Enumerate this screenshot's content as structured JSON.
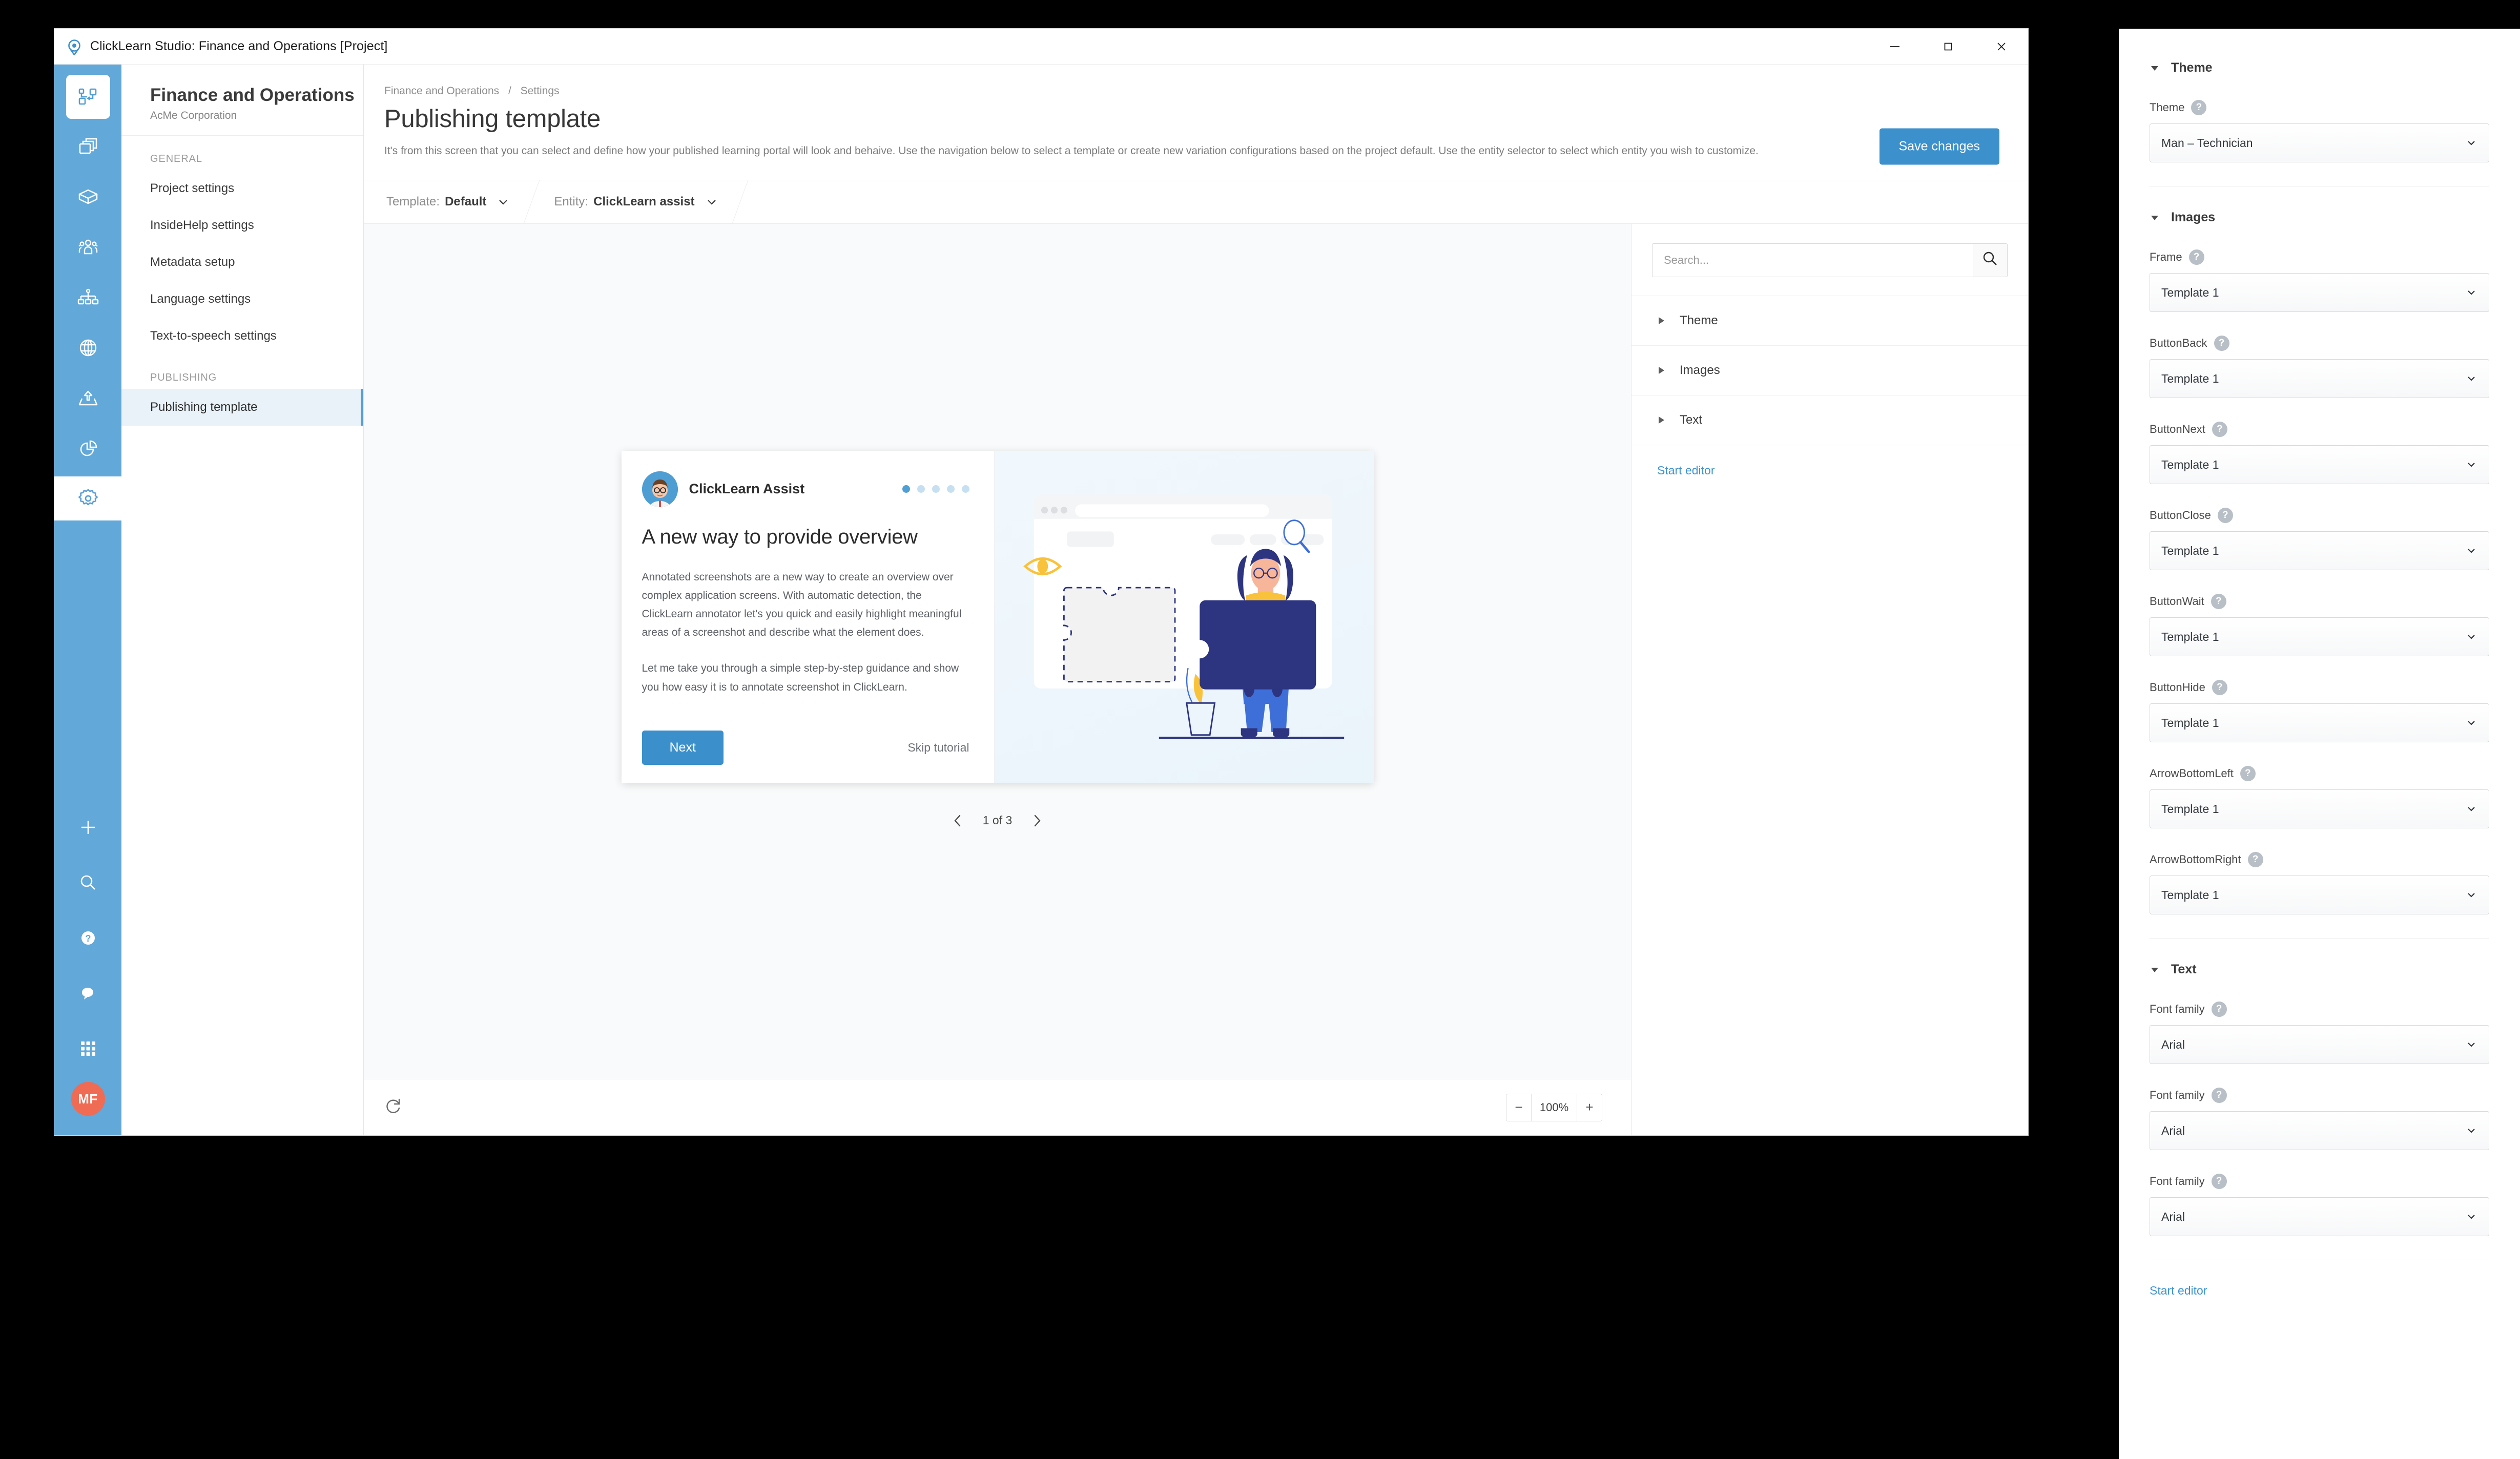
{
  "window": {
    "title": "ClickLearn Studio: Finance and Operations [Project]",
    "logo_icon": "clicklearn-logo-icon",
    "minimize_icon": "minimize-icon",
    "maximize_icon": "maximize-icon",
    "close_icon": "close-icon"
  },
  "rail": {
    "top_icons": [
      {
        "name": "project-overview-icon",
        "active": true
      },
      {
        "name": "copy-pages-icon",
        "active": false
      },
      {
        "name": "package-box-icon",
        "active": false
      },
      {
        "name": "audience-group-icon",
        "active": false
      },
      {
        "name": "sitemap-hierarchy-icon",
        "active": false
      },
      {
        "name": "globe-language-icon",
        "active": false
      },
      {
        "name": "publish-upload-icon",
        "active": false
      },
      {
        "name": "analytics-pie-icon",
        "active": false
      },
      {
        "name": "settings-gear-icon",
        "active": true
      }
    ],
    "bottom_icons": [
      {
        "name": "add-plus-icon"
      },
      {
        "name": "search-icon"
      },
      {
        "name": "help-question-icon"
      },
      {
        "name": "feedback-chat-icon"
      },
      {
        "name": "apps-grid-icon"
      }
    ],
    "avatar_initials": "MF"
  },
  "nav": {
    "project_title": "Finance and Operations",
    "project_subtitle": "AcMe Corporation",
    "groups": [
      {
        "label": "GENERAL",
        "items": [
          {
            "label": "Project settings",
            "selected": false
          },
          {
            "label": "InsideHelp settings",
            "selected": false
          },
          {
            "label": "Metadata setup",
            "selected": false
          },
          {
            "label": "Language settings",
            "selected": false
          },
          {
            "label": "Text-to-speech settings",
            "selected": false
          }
        ]
      },
      {
        "label": "PUBLISHING",
        "items": [
          {
            "label": "Publishing template",
            "selected": true
          }
        ]
      }
    ]
  },
  "content": {
    "breadcrumb": {
      "root": "Finance and Operations",
      "separator": "/",
      "current": "Settings"
    },
    "page_title": "Publishing template",
    "page_description": "It's from this screen that you can select and define how your published learning portal will look and behaive. Use the navigation below to select a template or create new variation configurations based on the project default. Use the entity selector to select which entity you wish to customize.",
    "save_label": "Save changes",
    "selectors": [
      {
        "label": "Template:",
        "value": "Default",
        "icon": "chevron-down-icon"
      },
      {
        "label": "Entity:",
        "value": "ClickLearn assist",
        "icon": "chevron-down-icon"
      }
    ]
  },
  "preview": {
    "assistant_name": "ClickLearn Assist",
    "dots_total": 5,
    "dots_active_index": 0,
    "heading": "A new way to provide overview",
    "paragraph1": "Annotated screenshots are a new way to create an overview over complex application screens. With automatic detection, the ClickLearn annotator let's you quick and easily highlight meaningful areas of a screenshot and describe what the element does.",
    "paragraph2": "Let me take you through a simple step-by-step guidance and show you how easy it is to annotate screenshot in ClickLearn.",
    "next_label": "Next",
    "skip_label": "Skip tutorial",
    "pager": {
      "prev_icon": "chevron-left-icon",
      "next_icon": "chevron-right-icon",
      "current": "1",
      "of_word": "of",
      "total": "3",
      "text": "1 of 3"
    }
  },
  "canvas_footer": {
    "refresh_icon": "refresh-icon",
    "zoom_out_label": "−",
    "zoom_value": "100%",
    "zoom_in_label": "+"
  },
  "accordion": {
    "search_placeholder": "Search...",
    "search_value": "",
    "search_icon": "search-icon",
    "rows": [
      {
        "label": "Theme",
        "icon": "triangle-right-icon"
      },
      {
        "label": "Images",
        "icon": "triangle-right-icon"
      },
      {
        "label": "Text",
        "icon": "triangle-right-icon"
      }
    ],
    "start_editor_label": "Start editor"
  },
  "properties": {
    "sections": [
      {
        "title": "Theme",
        "icon": "triangle-down-icon",
        "fields": [
          {
            "label": "Theme",
            "value": "Man – Technician",
            "help_icon": "help-question-icon",
            "chevron_icon": "chevron-down-icon"
          }
        ]
      },
      {
        "title": "Images",
        "icon": "triangle-down-icon",
        "fields": [
          {
            "label": "Frame",
            "value": "Template 1",
            "help_icon": "help-question-icon",
            "chevron_icon": "chevron-down-icon"
          },
          {
            "label": "ButtonBack",
            "value": "Template 1",
            "help_icon": "help-question-icon",
            "chevron_icon": "chevron-down-icon"
          },
          {
            "label": "ButtonNext",
            "value": "Template 1",
            "help_icon": "help-question-icon",
            "chevron_icon": "chevron-down-icon"
          },
          {
            "label": "ButtonClose",
            "value": "Template 1",
            "help_icon": "help-question-icon",
            "chevron_icon": "chevron-down-icon"
          },
          {
            "label": "ButtonWait",
            "value": "Template 1",
            "help_icon": "help-question-icon",
            "chevron_icon": "chevron-down-icon"
          },
          {
            "label": "ButtonHide",
            "value": "Template 1",
            "help_icon": "help-question-icon",
            "chevron_icon": "chevron-down-icon"
          },
          {
            "label": "ArrowBottomLeft",
            "value": "Template 1",
            "help_icon": "help-question-icon",
            "chevron_icon": "chevron-down-icon"
          },
          {
            "label": "ArrowBottomRight",
            "value": "Template 1",
            "help_icon": "help-question-icon",
            "chevron_icon": "chevron-down-icon"
          }
        ]
      },
      {
        "title": "Text",
        "icon": "triangle-down-icon",
        "fields": [
          {
            "label": "Font family",
            "value": "Arial",
            "help_icon": "help-question-icon",
            "chevron_icon": "chevron-down-icon"
          },
          {
            "label": "Font family",
            "value": "Arial",
            "help_icon": "help-question-icon",
            "chevron_icon": "chevron-down-icon"
          },
          {
            "label": "Font family",
            "value": "Arial",
            "help_icon": "help-question-icon",
            "chevron_icon": "chevron-down-icon"
          }
        ]
      }
    ],
    "start_editor_label": "Start editor"
  },
  "colors": {
    "rail_blue": "#62a8d8",
    "accent_blue": "#3c90cb",
    "link_blue": "#3f93cf",
    "selected_nav": "#e9f2f9",
    "avatar_red": "#ef6b54",
    "illustration_navy": "#2d3580",
    "illustration_yellow": "#f9c23c",
    "illustration_blue": "#3e6fd9"
  }
}
